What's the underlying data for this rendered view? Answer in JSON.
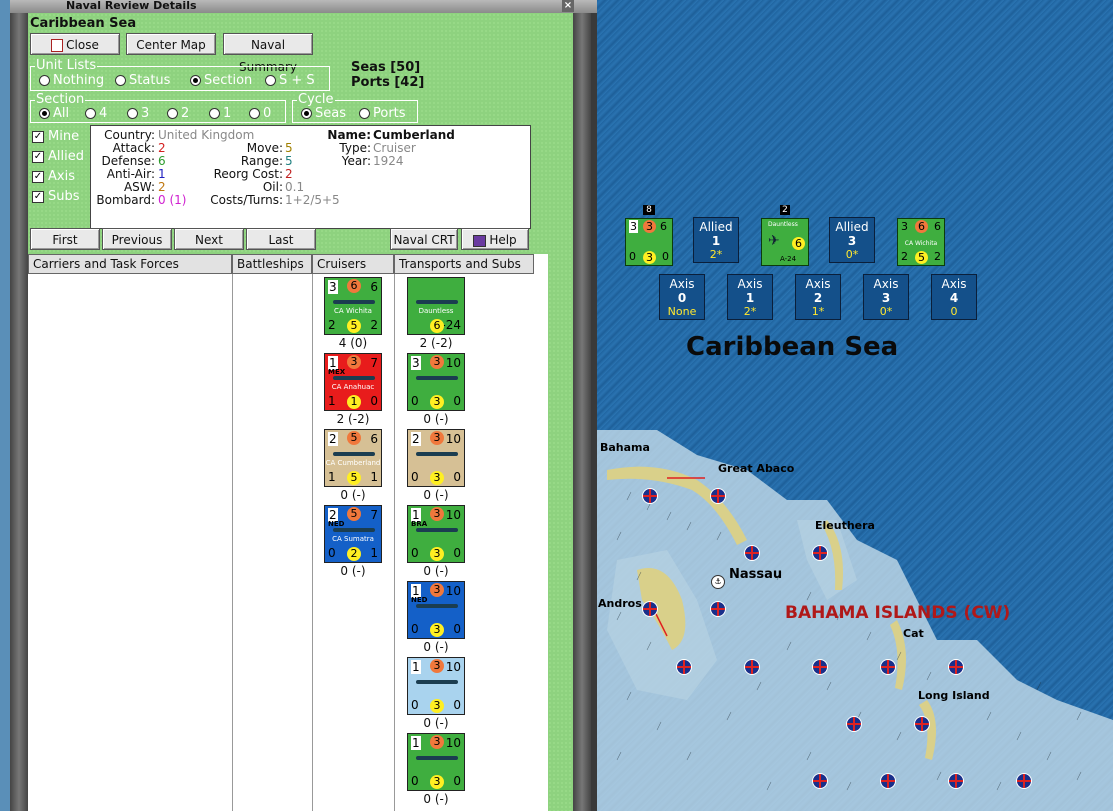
{
  "window": {
    "title": "Naval Review Details",
    "sea_name": "Caribbean Sea"
  },
  "buttons": {
    "close": "Close",
    "center_map": "Center Map",
    "naval_summary": "Naval Summary",
    "first": "First",
    "previous": "Previous",
    "next": "Next",
    "last": "Last",
    "naval_crt": "Naval CRT",
    "help": "Help"
  },
  "counts": {
    "seas": "Seas [50]",
    "ports": "Ports [42]"
  },
  "unit_lists": {
    "legend": "Unit Lists",
    "options": [
      "Nothing",
      "Status",
      "Section",
      "S + S"
    ],
    "selected": "Section"
  },
  "section": {
    "legend": "Section",
    "options": [
      "All",
      "4",
      "3",
      "2",
      "1",
      "0"
    ],
    "selected": "All"
  },
  "cycle": {
    "legend": "Cycle",
    "options": [
      "Seas",
      "Ports"
    ],
    "selected": "Seas"
  },
  "filters": [
    {
      "label": "Mine",
      "checked": true
    },
    {
      "label": "Allied",
      "checked": true
    },
    {
      "label": "Axis",
      "checked": true
    },
    {
      "label": "Subs",
      "checked": true
    }
  ],
  "unit_info": {
    "country_label": "Country:",
    "country": "United Kingdom",
    "attack_label": "Attack:",
    "attack": "2",
    "defense_label": "Defense:",
    "defense": "6",
    "antiair_label": "Anti-Air:",
    "antiair": "1",
    "asw_label": "ASW:",
    "asw": "2",
    "bombard_label": "Bombard:",
    "bombard": "0 (1)",
    "move_label": "Move:",
    "move": "5",
    "range_label": "Range:",
    "range": "5",
    "reorg_label": "Reorg Cost:",
    "reorg": "2",
    "oil_label": "Oil:",
    "oil": "0.1",
    "costs_label": "Costs/Turns:",
    "costs": "1+2/5+5",
    "name_label": "Name:",
    "name": "Cumberland",
    "type_label": "Type:",
    "type": "Cruiser",
    "year_label": "Year:",
    "year": "1924",
    "colors": {
      "attack": "#d42020",
      "defense": "#2a9a2a",
      "antiair": "#2020c0",
      "asw": "#c07810",
      "bombard": "#d020d0",
      "move": "#a08000",
      "range": "#208080",
      "reorg": "#c02020",
      "grey": "#888888"
    }
  },
  "columns": [
    "Carriers and Task Forces",
    "Battleships",
    "Cruisers",
    "Transports and Subs"
  ],
  "cruisers": [
    {
      "tl": "3",
      "oc": "6",
      "tr": "6",
      "name": "CA Wichita",
      "bl": "2",
      "yc": "5",
      "br": "2",
      "caption": "4 (0)",
      "color": "#3fae3f",
      "flag": ""
    },
    {
      "tl": "1",
      "oc": "3",
      "tr": "7",
      "name": "CA Anahuac",
      "bl": "1",
      "yc": "1",
      "br": "0",
      "caption": "2 (-2)",
      "color": "#e81c1c",
      "flag": "MEX"
    },
    {
      "tl": "2",
      "oc": "5",
      "tr": "6",
      "name": "CA Cumberland",
      "bl": "1",
      "yc": "5",
      "br": "1",
      "caption": "0 (-)",
      "color": "#d6c095",
      "flag": ""
    },
    {
      "tl": "2",
      "oc": "5",
      "tr": "7",
      "name": "CA Sumatra",
      "bl": "0",
      "yc": "2",
      "br": "1",
      "caption": "0 (-)",
      "color": "#1460c8",
      "flag": "NED"
    }
  ],
  "transports": [
    {
      "tl": "",
      "oc": "",
      "tr": "",
      "name": "Dauntless",
      "bl": "",
      "yc": "6",
      "br": "A-24",
      "caption": "2 (-2)",
      "color": "#3fae3f",
      "flag": ""
    },
    {
      "tl": "3",
      "oc": "3",
      "tr": "10",
      "name": "",
      "bl": "0",
      "yc": "3",
      "br": "0",
      "caption": "0 (-)",
      "color": "#3fae3f",
      "flag": ""
    },
    {
      "tl": "2",
      "oc": "3",
      "tr": "10",
      "name": "",
      "bl": "0",
      "yc": "3",
      "br": "0",
      "caption": "0 (-)",
      "color": "#d6c095",
      "flag": ""
    },
    {
      "tl": "1",
      "oc": "3",
      "tr": "10",
      "name": "",
      "bl": "0",
      "yc": "3",
      "br": "0",
      "caption": "0 (-)",
      "color": "#3fae3f",
      "flag": "BRA"
    },
    {
      "tl": "1",
      "oc": "3",
      "tr": "10",
      "name": "",
      "bl": "0",
      "yc": "3",
      "br": "0",
      "caption": "0 (-)",
      "color": "#1460c8",
      "flag": "NED"
    },
    {
      "tl": "1",
      "oc": "3",
      "tr": "10",
      "name": "",
      "bl": "0",
      "yc": "3",
      "br": "0",
      "caption": "0 (-)",
      "color": "#a9d3ee",
      "flag": ""
    },
    {
      "tl": "1",
      "oc": "3",
      "tr": "10",
      "name": "",
      "bl": "0",
      "yc": "3",
      "br": "0",
      "caption": "0 (-)",
      "color": "#3fae3f",
      "flag": ""
    }
  ],
  "map": {
    "sea_title": "Caribbean Sea",
    "region": "BAHAMA ISLANDS (CW)",
    "places": [
      "Bahama",
      "Great Abaco",
      "Eleuthera",
      "Nassau",
      "Andros",
      "Cat",
      "Long Island"
    ],
    "allied_boxes": [
      {
        "label": "Allied",
        "num": "1",
        "sub": "2*"
      },
      {
        "label": "Allied",
        "num": "3",
        "sub": "0*"
      }
    ],
    "axis_boxes": [
      {
        "label": "Axis",
        "num": "0",
        "sub": "None"
      },
      {
        "label": "Axis",
        "num": "1",
        "sub": "2*"
      },
      {
        "label": "Axis",
        "num": "2",
        "sub": "1*"
      },
      {
        "label": "Axis",
        "num": "3",
        "sub": "0*"
      },
      {
        "label": "Axis",
        "num": "4",
        "sub": "0"
      }
    ],
    "stack_counts": [
      "8",
      "2"
    ],
    "map_counter_1": {
      "tl": "3",
      "oc": "3",
      "tr": "6",
      "bl": "0",
      "yc": "3",
      "br": "0"
    },
    "map_counter_2": {
      "name": "Dauntless",
      "yc": "6",
      "br": "A-24"
    },
    "map_counter_3": {
      "tl": "3",
      "oc": "6",
      "tr": "6",
      "name": "CA Wichita",
      "bl": "2",
      "yc": "5",
      "br": "2"
    }
  }
}
